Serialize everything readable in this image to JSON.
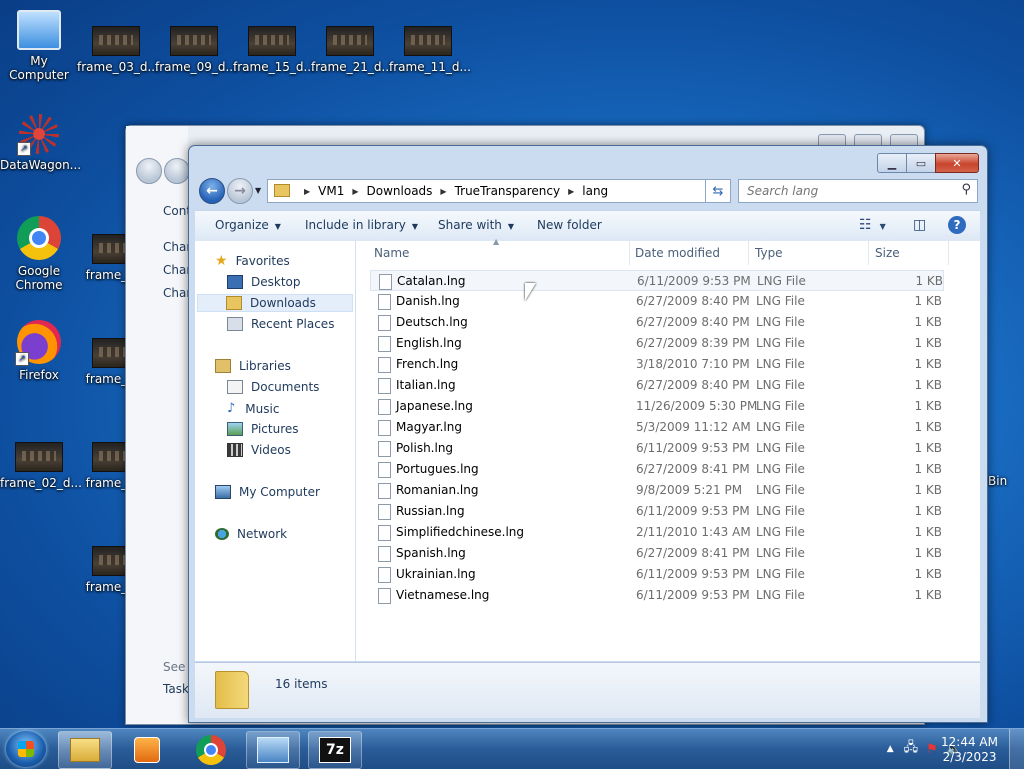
{
  "desktop": {
    "icons": [
      {
        "label": "My Computer"
      },
      {
        "label": "frame_03_d..."
      },
      {
        "label": "frame_09_d..."
      },
      {
        "label": "frame_15_d..."
      },
      {
        "label": "frame_21_d..."
      },
      {
        "label": "frame_11_d..."
      },
      {
        "label": "DataWagon..."
      },
      {
        "label": "Google Chrome"
      },
      {
        "label": "Firefox"
      },
      {
        "label": "frame_02_d..."
      },
      {
        "label": "frame_0..."
      },
      {
        "label": "frame_0..."
      },
      {
        "label": "frame_0..."
      },
      {
        "label": "frame_0..."
      },
      {
        "label": "frame_0..."
      },
      {
        "label": "Bin"
      }
    ]
  },
  "bg_window": {
    "items": [
      "Cont",
      "Chan",
      "Chan",
      "Chan",
      "See a",
      "Task"
    ]
  },
  "explorer": {
    "breadcrumb": [
      "VM1",
      "Downloads",
      "TrueTransparency",
      "lang"
    ],
    "search_placeholder": "Search lang",
    "toolbar": {
      "organize": "Organize",
      "include": "Include in library",
      "share": "Share with",
      "new_folder": "New folder"
    },
    "nav": {
      "favorites": "Favorites",
      "desktop": "Desktop",
      "downloads": "Downloads",
      "recent": "Recent Places",
      "libraries": "Libraries",
      "documents": "Documents",
      "music": "Music",
      "pictures": "Pictures",
      "videos": "Videos",
      "computer": "My Computer",
      "network": "Network"
    },
    "columns": {
      "name": "Name",
      "date": "Date modified",
      "type": "Type",
      "size": "Size"
    },
    "files": [
      {
        "name": "Catalan.lng",
        "date": "6/11/2009 9:53 PM",
        "type": "LNG File",
        "size": "1 KB"
      },
      {
        "name": "Danish.lng",
        "date": "6/27/2009 8:40 PM",
        "type": "LNG File",
        "size": "1 KB"
      },
      {
        "name": "Deutsch.lng",
        "date": "6/27/2009 8:40 PM",
        "type": "LNG File",
        "size": "1 KB"
      },
      {
        "name": "English.lng",
        "date": "6/27/2009 8:39 PM",
        "type": "LNG File",
        "size": "1 KB"
      },
      {
        "name": "French.lng",
        "date": "3/18/2010 7:10 PM",
        "type": "LNG File",
        "size": "1 KB"
      },
      {
        "name": "Italian.lng",
        "date": "6/27/2009 8:40 PM",
        "type": "LNG File",
        "size": "1 KB"
      },
      {
        "name": "Japanese.lng",
        "date": "11/26/2009 5:30 PM",
        "type": "LNG File",
        "size": "1 KB"
      },
      {
        "name": "Magyar.lng",
        "date": "5/3/2009 11:12 AM",
        "type": "LNG File",
        "size": "1 KB"
      },
      {
        "name": "Polish.lng",
        "date": "6/11/2009 9:53 PM",
        "type": "LNG File",
        "size": "1 KB"
      },
      {
        "name": "Portugues.lng",
        "date": "6/27/2009 8:41 PM",
        "type": "LNG File",
        "size": "1 KB"
      },
      {
        "name": "Romanian.lng",
        "date": "9/8/2009 5:21 PM",
        "type": "LNG File",
        "size": "1 KB"
      },
      {
        "name": "Russian.lng",
        "date": "6/11/2009 9:53 PM",
        "type": "LNG File",
        "size": "1 KB"
      },
      {
        "name": "Simplifiedchinese.lng",
        "date": "2/11/2010 1:43 AM",
        "type": "LNG File",
        "size": "1 KB"
      },
      {
        "name": "Spanish.lng",
        "date": "6/27/2009 8:41 PM",
        "type": "LNG File",
        "size": "1 KB"
      },
      {
        "name": "Ukrainian.lng",
        "date": "6/11/2009 9:53 PM",
        "type": "LNG File",
        "size": "1 KB"
      },
      {
        "name": "Vietnamese.lng",
        "date": "6/11/2009 9:53 PM",
        "type": "LNG File",
        "size": "1 KB"
      }
    ],
    "status_count": "16 items"
  },
  "taskbar": {
    "time": "12:44 AM",
    "date": "2/3/2023",
    "apps": [
      "windows-explorer",
      "media-player",
      "google-chrome",
      "network-app",
      "7-zip"
    ],
    "sevenzip_label": "7z"
  },
  "colors": {
    "accent": "#2f6cc0",
    "desktop": "#1a6fc6"
  }
}
